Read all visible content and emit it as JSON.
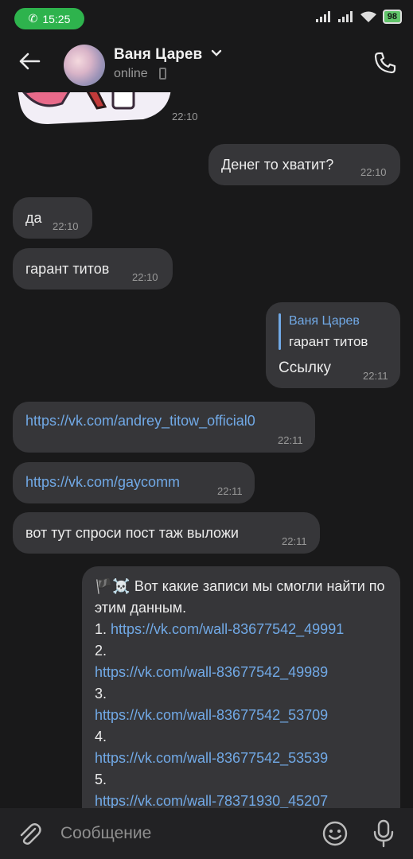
{
  "status_bar": {
    "time": "15:25",
    "battery": "98"
  },
  "header": {
    "contact_name": "Ваня Царев",
    "status": "online"
  },
  "messages": {
    "sticker_time": "22:10",
    "m1": {
      "text": "Денег то хватит?",
      "time": "22:10"
    },
    "m2": {
      "text": "да",
      "time": "22:10"
    },
    "m3": {
      "text": "гарант титов",
      "time": "22:10"
    },
    "m4": {
      "reply_author": "Ваня Царев",
      "reply_text": "гарант титов",
      "text": "Ссылку",
      "time": "22:11"
    },
    "m5": {
      "text": "https://vk.com/andrey_titow_official0",
      "time": "22:11"
    },
    "m6": {
      "text": "https://vk.com/gaycomm",
      "time": "22:11"
    },
    "m7": {
      "text": "вот тут спроси пост таж выложи",
      "time": "22:11"
    },
    "m8": {
      "intro": "🏴☠️ Вот какие записи мы смогли найти по этим данным.",
      "items": [
        {
          "n": "1.",
          "url": "https://vk.com/wall-83677542_49991"
        },
        {
          "n": "2.",
          "url": "https://vk.com/wall-83677542_49989"
        },
        {
          "n": "3.",
          "url": "https://vk.com/wall-83677542_53709"
        },
        {
          "n": "4.",
          "url": "https://vk.com/wall-83677542_53539"
        },
        {
          "n": "5.",
          "url": "https://vk.com/wall-78371930_45207"
        }
      ]
    }
  },
  "composer": {
    "placeholder": "Сообщение"
  }
}
